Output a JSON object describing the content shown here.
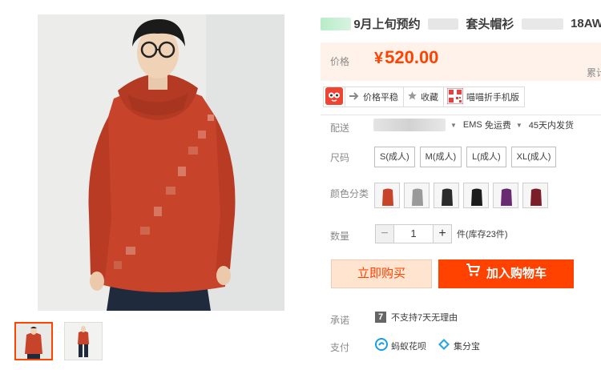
{
  "product": {
    "title_prefix": "9月上旬预约",
    "title_middle": "套头帽衫",
    "title_suffix": "18AW"
  },
  "price": {
    "label": "价格",
    "currency": "¥",
    "value": "520.00",
    "sold_label": "累计"
  },
  "tools": [
    {
      "label": "价格平稳",
      "icon": "arrow-right-icon"
    },
    {
      "label": "收藏",
      "icon": "star-icon"
    },
    {
      "label": "喵喵折手机版",
      "icon": "qr-code-icon"
    }
  ],
  "shipping": {
    "label": "配送",
    "service": "EMS",
    "fee": "免运费",
    "delivery": "45天内发货"
  },
  "size": {
    "label": "尺码",
    "options": [
      "S(成人)",
      "M(成人)",
      "L(成人)",
      "XL(成人)"
    ]
  },
  "color": {
    "label": "颜色分类",
    "swatches": [
      "#c7432a",
      "#9a9a9a",
      "#2b2b2b",
      "#1c1c1c",
      "#6a2a72",
      "#7a1e2a"
    ]
  },
  "quantity": {
    "label": "数量",
    "value": "1",
    "minus": "−",
    "plus": "+",
    "stock": "件(库存23件)"
  },
  "actions": {
    "buy_now": "立即购买",
    "add_to_cart": "加入购物车"
  },
  "promise": {
    "label": "承诺",
    "badge": "7",
    "text": "不支持7天无理由"
  },
  "payment": {
    "label": "支付",
    "methods": [
      {
        "label": "蚂蚁花呗",
        "icon": "huabei-icon"
      },
      {
        "label": "集分宝",
        "icon": "jifenbao-icon"
      }
    ]
  },
  "colors": {
    "accent": "#ff4200",
    "price_bg": "#fef2ea",
    "hoodie": "#c7432a"
  }
}
